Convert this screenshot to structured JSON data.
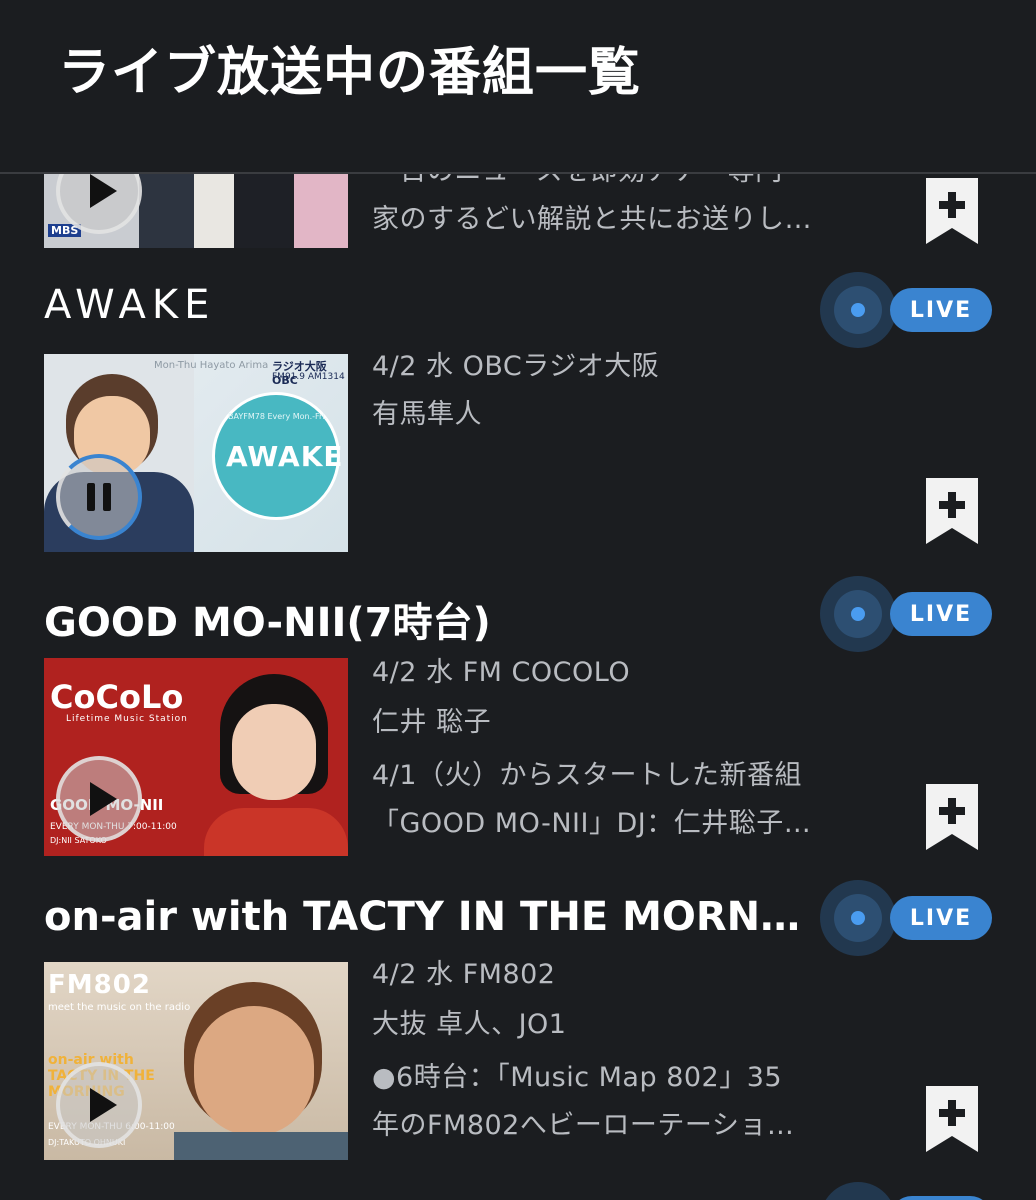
{
  "header": {
    "title": "ライブ放送中の番組一覧"
  },
  "programs": [
    {
      "title": "",
      "desc_lines": [
        "一日のニュースを即効アナ・専門",
        "家のするどい解説と共にお送りし…"
      ],
      "thumb_logo": "MBS"
    },
    {
      "title": "AWAKE",
      "live": "LIVE",
      "meta_date_station": "4/2 水 OBCラジオ大阪",
      "meta_personality": "有馬隼人",
      "thumb_logo": "ラジオ大阪 OBC",
      "thumb_freq": "FM91.9 AM1314",
      "thumb_caption": "Mon-Thu Hayato Arima",
      "thumb_circle_text": "AWAKE",
      "thumb_circle_sub": "BAYFM78 Every Mon.-Fri."
    },
    {
      "title": "GOOD MO-NII(7時台)",
      "live": "LIVE",
      "meta_date_station": "4/2 水 FM COCOLO",
      "meta_personality": "仁井 聡子",
      "desc_lines": [
        "4/1（火）からスタートした新番組",
        "「GOOD MO-NII」DJ：仁井聡子…"
      ],
      "thumb_logo": "CoCoLo",
      "thumb_logo_sub": "Lifetime Music Station",
      "thumb_show": "GOOD MO-NII",
      "thumb_time": "EVERY MON-THU 7:00-11:00",
      "thumb_dj": "DJ:NII SATOKO"
    },
    {
      "title": "on-air with TACTY IN THE MORNIN…",
      "live": "LIVE",
      "meta_date_station": "4/2 水 FM802",
      "meta_personality": "大抜 卓人、JO1",
      "desc_lines": [
        "●6時台：「Music Map 802」35",
        "年のFM802へビーローテーショ…"
      ],
      "thumb_logo": "FM802",
      "thumb_logo_sub": "meet the music on the radio",
      "thumb_show": "on-air with TACTY IN THE MORNING",
      "thumb_time": "EVERY MON-THU 6:00-11:00",
      "thumb_dj": "DJ:TAKUTO OHNUKI"
    }
  ],
  "icons": {
    "play": "play-icon",
    "pause": "pause-icon",
    "bookmark": "bookmark-add-icon",
    "live_dot": "live-radio-icon"
  },
  "colors": {
    "background": "#1b1d20",
    "live_pill": "#3a84d0",
    "text_secondary": "#b9bcc1"
  }
}
